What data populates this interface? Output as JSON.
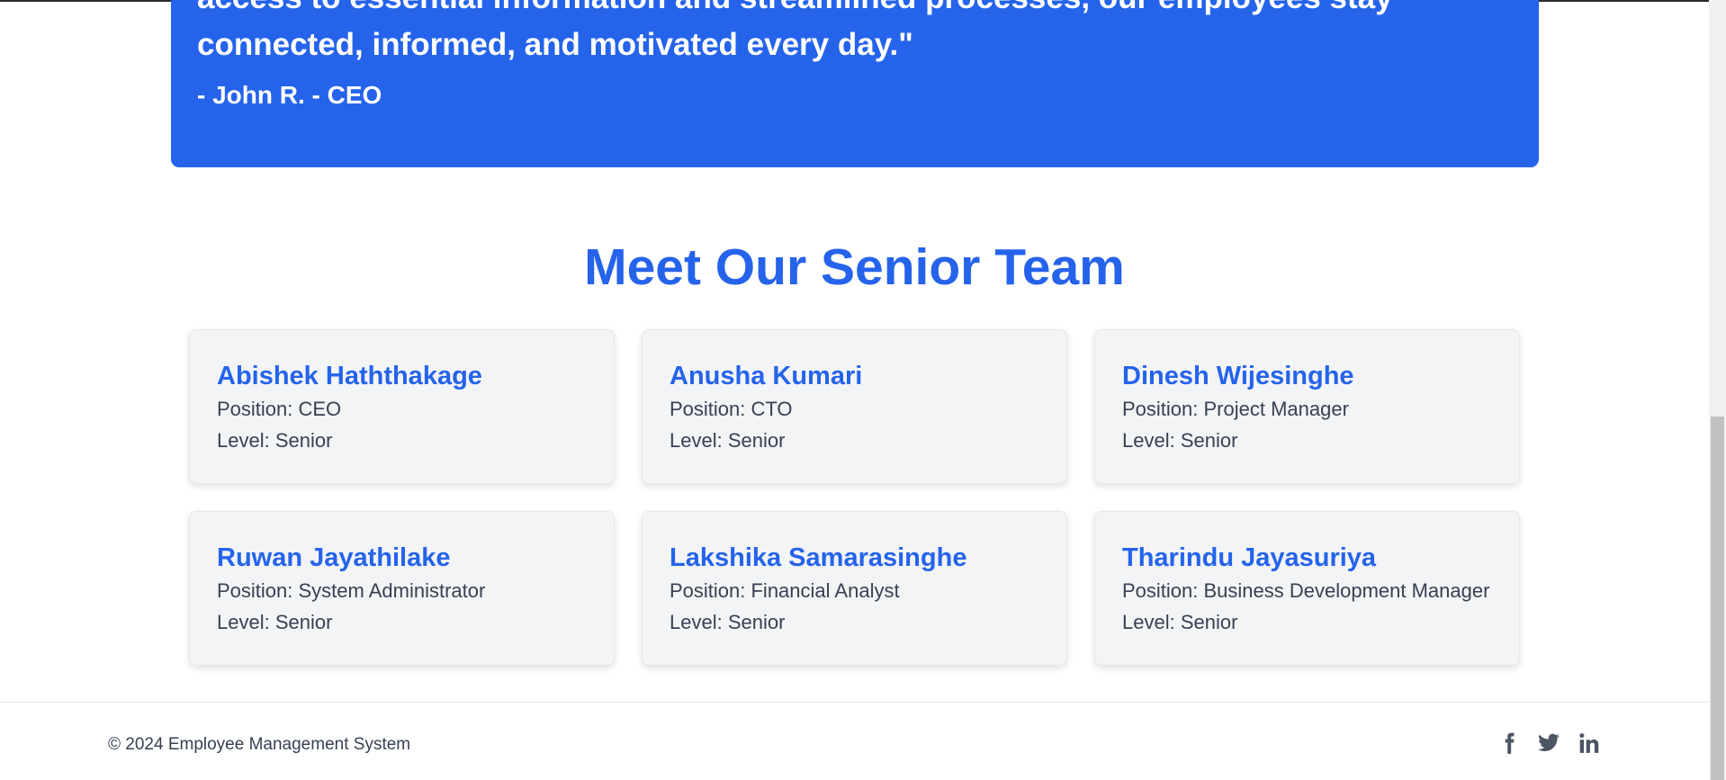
{
  "quote": {
    "text": "access to essential information and streamlined processes, our employees stay connected, informed, and motivated every day.\"",
    "author": "- John R. - CEO"
  },
  "team": {
    "title": "Meet Our Senior Team",
    "members": [
      {
        "name": "Abishek Haththakage",
        "position": "Position: CEO",
        "level": "Level: Senior"
      },
      {
        "name": "Anusha Kumari",
        "position": "Position: CTO",
        "level": "Level: Senior"
      },
      {
        "name": "Dinesh Wijesinghe",
        "position": "Position: Project Manager",
        "level": "Level: Senior"
      },
      {
        "name": "Ruwan Jayathilake",
        "position": "Position: System Administrator",
        "level": "Level: Senior"
      },
      {
        "name": "Lakshika Samarasinghe",
        "position": "Position: Financial Analyst",
        "level": "Level: Senior"
      },
      {
        "name": "Tharindu Jayasuriya",
        "position": "Position: Business Development Manager",
        "level": "Level: Senior"
      }
    ]
  },
  "footer": {
    "copyright": "© 2024 Employee Management System",
    "social_icons": [
      "facebook-icon",
      "twitter-icon",
      "linkedin-icon"
    ]
  },
  "colors": {
    "accent": "#2563eb",
    "card_bg": "#f3f4f6",
    "text": "#374151",
    "icon": "#4b5563"
  }
}
